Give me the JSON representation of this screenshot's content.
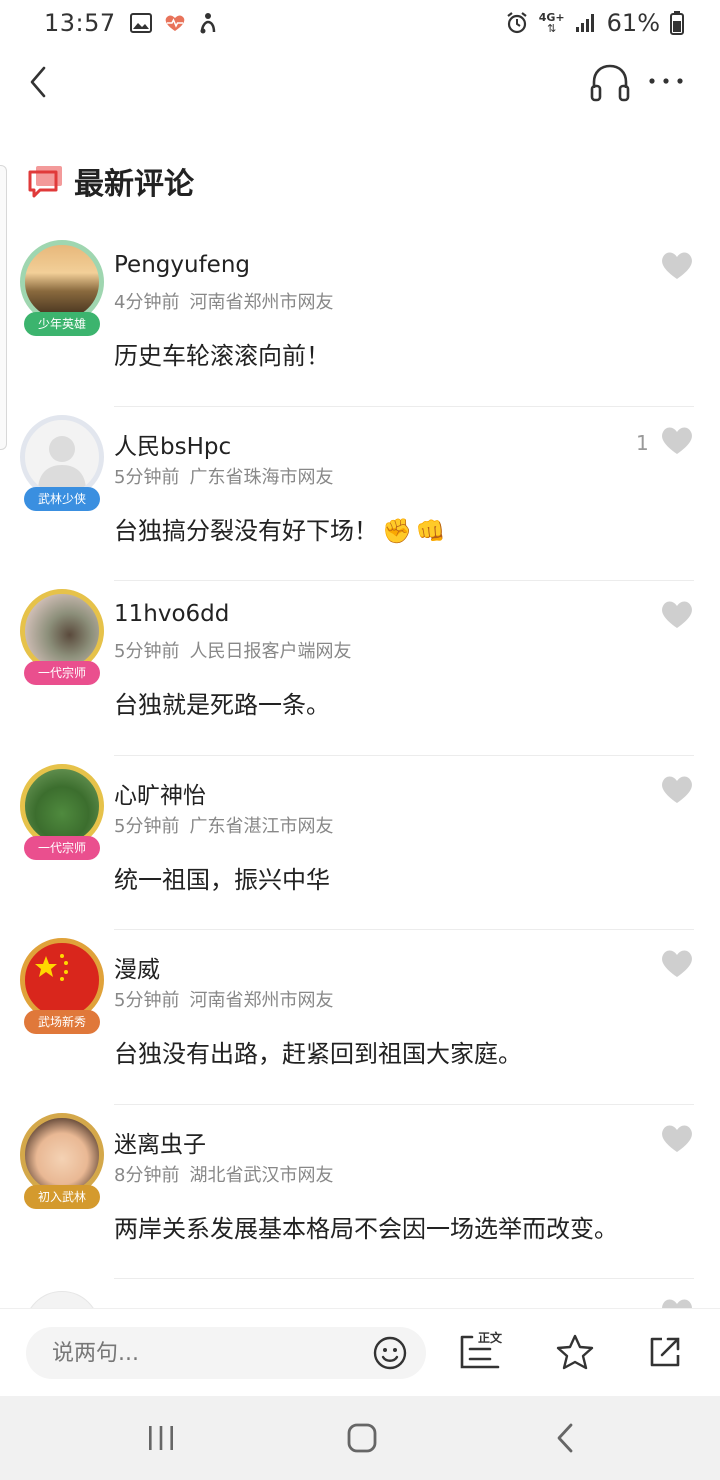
{
  "status_bar": {
    "time": "13:57",
    "network": "4G+",
    "battery": "61%",
    "icons": [
      "image-icon",
      "health-heart-icon",
      "accessibility-icon",
      "alarm-icon",
      "data-arrows-icon",
      "signal-icon",
      "battery-icon"
    ]
  },
  "top_bar": {
    "icons": [
      "back-arrow-icon",
      "headphones-icon",
      "more-dots-icon"
    ]
  },
  "section": {
    "title": "最新评论"
  },
  "comments": [
    {
      "name": "Pengyufeng",
      "time": "4分钟前",
      "location": "河南省郑州市网友",
      "text": "历史车轮滚滚向前！",
      "badge": "少年英雄",
      "badge_color": "#3cb46e",
      "likes": ""
    },
    {
      "name": "人民bsHpc",
      "time": "5分钟前",
      "location": "广东省珠海市网友",
      "text": "台独搞分裂没有好下场！",
      "emojis": [
        "raised-fist-emoji",
        "oncoming-fist-emoji"
      ],
      "badge": "武林少侠",
      "badge_color": "#3a8fe0",
      "likes": "1"
    },
    {
      "name": "11hvo6dd",
      "time": "5分钟前",
      "location": "人民日报客户端网友",
      "text": "台独就是死路一条。",
      "badge": "一代宗师",
      "badge_color": "#ea4f8e",
      "likes": ""
    },
    {
      "name": "心旷神怡",
      "time": "5分钟前",
      "location": "广东省湛江市网友",
      "text": "统一祖国，振兴中华",
      "badge": "一代宗师",
      "badge_color": "#ea4f8e",
      "likes": ""
    },
    {
      "name": "漫威",
      "time": "5分钟前",
      "location": "河南省郑州市网友",
      "text": "台独没有出路，赶紧回到祖国大家庭。",
      "badge": "武场新秀",
      "badge_color": "#e0783a",
      "likes": ""
    },
    {
      "name": "迷离虫子",
      "time": "8分钟前",
      "location": "湖北省武汉市网友",
      "text": "两岸关系发展基本格局不会因一场选举而改变。",
      "badge": "初入武林",
      "badge_color": "#d49a2e",
      "likes": ""
    }
  ],
  "bottom_bar": {
    "placeholder": "说两句...",
    "zhengwen_label": "正文"
  },
  "colors": {
    "accent_red": "#e03a3a",
    "heart_gray": "#cfcfcf",
    "meta_gray": "#888888"
  }
}
